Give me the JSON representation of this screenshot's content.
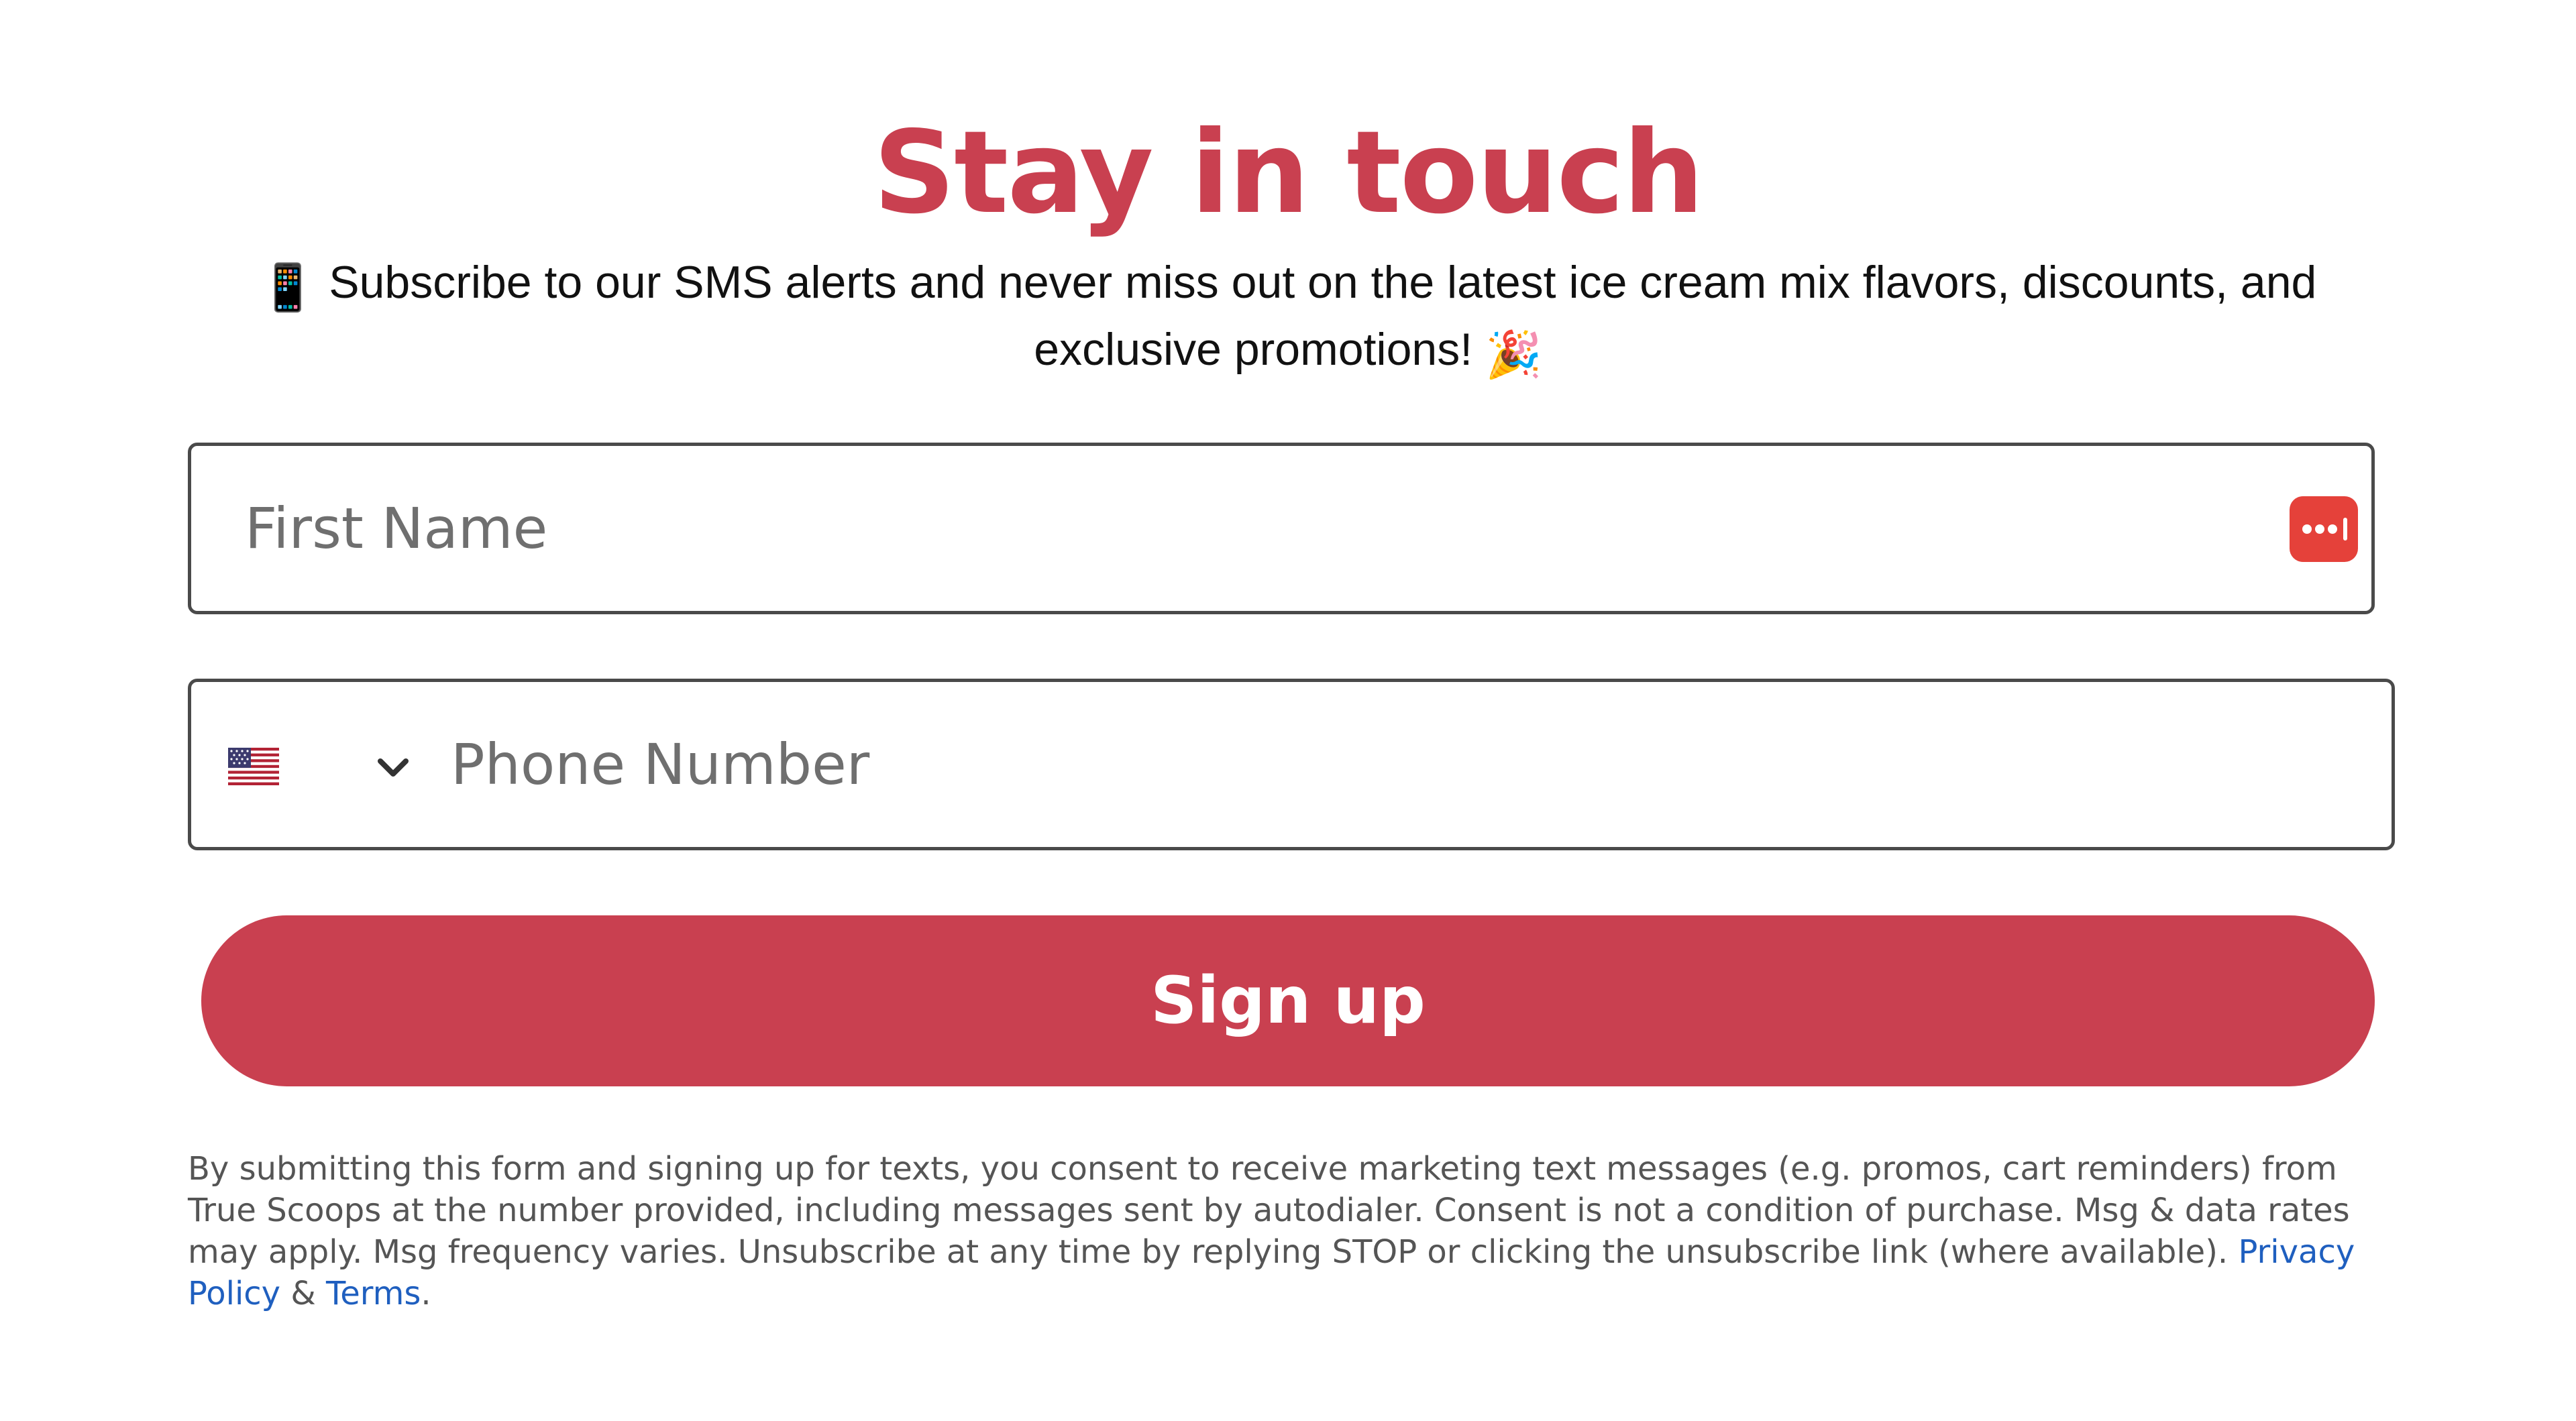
{
  "title": "Stay in touch",
  "subtitle": {
    "emoji_left": "📱",
    "text": "Subscribe to our SMS alerts and never miss out on the latest ice cream mix flavors, discounts, and exclusive promotions!",
    "emoji_right": "🎉"
  },
  "first_name": {
    "placeholder": "First Name",
    "value": "",
    "icon": "password-manager-icon"
  },
  "phone": {
    "country_flag": "us-flag-icon",
    "placeholder": "Phone Number",
    "value": ""
  },
  "signup_button": "Sign up",
  "disclaimer": {
    "text": "By submitting this form and signing up for texts, you consent to receive marketing text messages (e.g. promos, cart reminders) from True Scoops at the number provided, including messages sent by autodialer. Consent is not a condition of purchase. Msg & data rates may apply. Msg frequency varies. Unsubscribe at any time by replying STOP or clicking the unsubscribe link (where available).",
    "privacy_link": "Privacy Policy",
    "ampersand": "&",
    "terms_link": "Terms",
    "period": "."
  },
  "colors": {
    "brand": "#C94050",
    "link": "#1f5fbf",
    "password_icon": "#E5413A"
  }
}
